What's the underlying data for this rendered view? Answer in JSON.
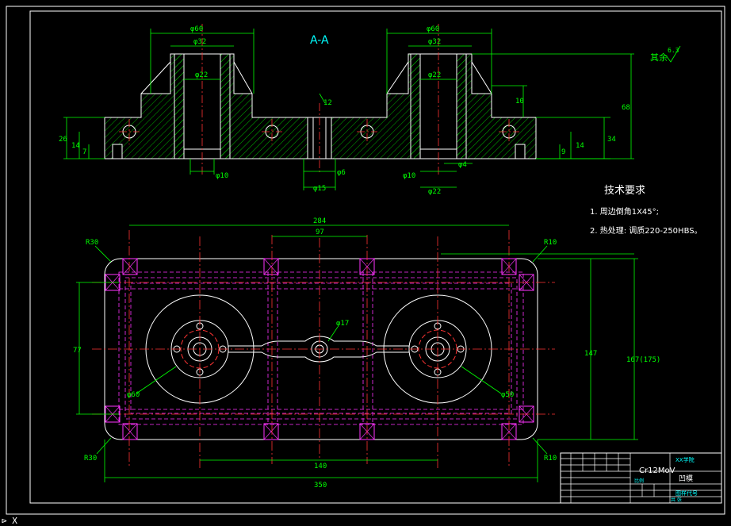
{
  "section_title": "A-A",
  "roughness_note": "其余",
  "roughness_value": "6.3",
  "tech_req": {
    "title": "技术要求",
    "items": [
      "1.  周边倒角1X45°;",
      "2.  热处理: 调质220-250HBS。"
    ]
  },
  "section_dims": {
    "left_d1": "φ60",
    "left_d2": "φ32",
    "left_d3": "φ22",
    "left_bottom": "φ10",
    "right_d1": "φ60",
    "right_d2": "φ32",
    "right_d3": "φ22",
    "right_bottom1": "φ10",
    "right_bottom2": "φ22",
    "center_d1": "φ6",
    "center_d2": "φ15",
    "center_top": "12",
    "h_left1": "26",
    "h_left2": "14",
    "h_left3": "7",
    "h_right1": "10",
    "h_right2": "68",
    "h_right3": "34",
    "h_right4": "14",
    "h_right5": "9",
    "w_small": "φ4"
  },
  "plan_dims": {
    "overall_top": "284",
    "inner_top": "97",
    "overall_bottom": "350",
    "inner_bottom": "140",
    "left_h": "77",
    "right_h1": "147",
    "right_h2": "167(175)",
    "r_tl": "R30",
    "r_tr": "R10",
    "r_bl": "R30",
    "r_br": "R10",
    "center_circle": "φ17",
    "left_circle": "φ60",
    "right_circle": "φ50"
  },
  "title_block": {
    "material": "Cr12MoV",
    "school": "XX学院",
    "part_name": "凹模",
    "drawing_no": "图样代号",
    "scale": "比例",
    "sheet": "共  张"
  },
  "bottom_prompt": "⊳ X"
}
